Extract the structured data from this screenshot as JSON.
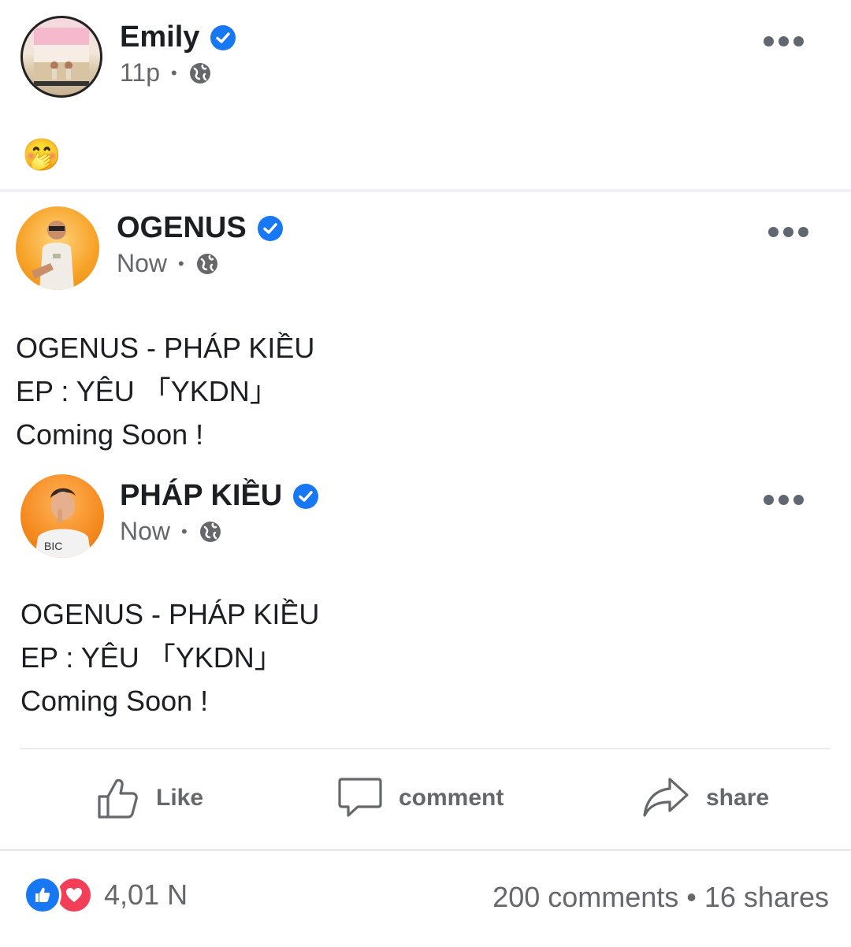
{
  "post": {
    "author": "Emily",
    "time": "11p",
    "privacy_icon": "globe-icon",
    "content_emoji": "🤭"
  },
  "shared_post": {
    "author": "OGENUS",
    "time": "Now",
    "lines": [
      "OGENUS - PHÁP KIỀU",
      "EP : YÊU 「YKDN」",
      "Coming Soon !"
    ]
  },
  "nested_post": {
    "author": "PHÁP KIỀU",
    "time": "Now",
    "lines": [
      "OGENUS - PHÁP KIỀU",
      "EP : YÊU 「YKDN」",
      "Coming Soon !"
    ]
  },
  "actions": {
    "like": "Like",
    "comment": "comment",
    "share": "share"
  },
  "stats": {
    "reactions": "4,01 N",
    "comments_shares": "200  comments • 16  shares"
  },
  "colors": {
    "verified": "#1877f2",
    "like": "#1877f2",
    "love": "#f33e58",
    "muted": "#65676b"
  }
}
